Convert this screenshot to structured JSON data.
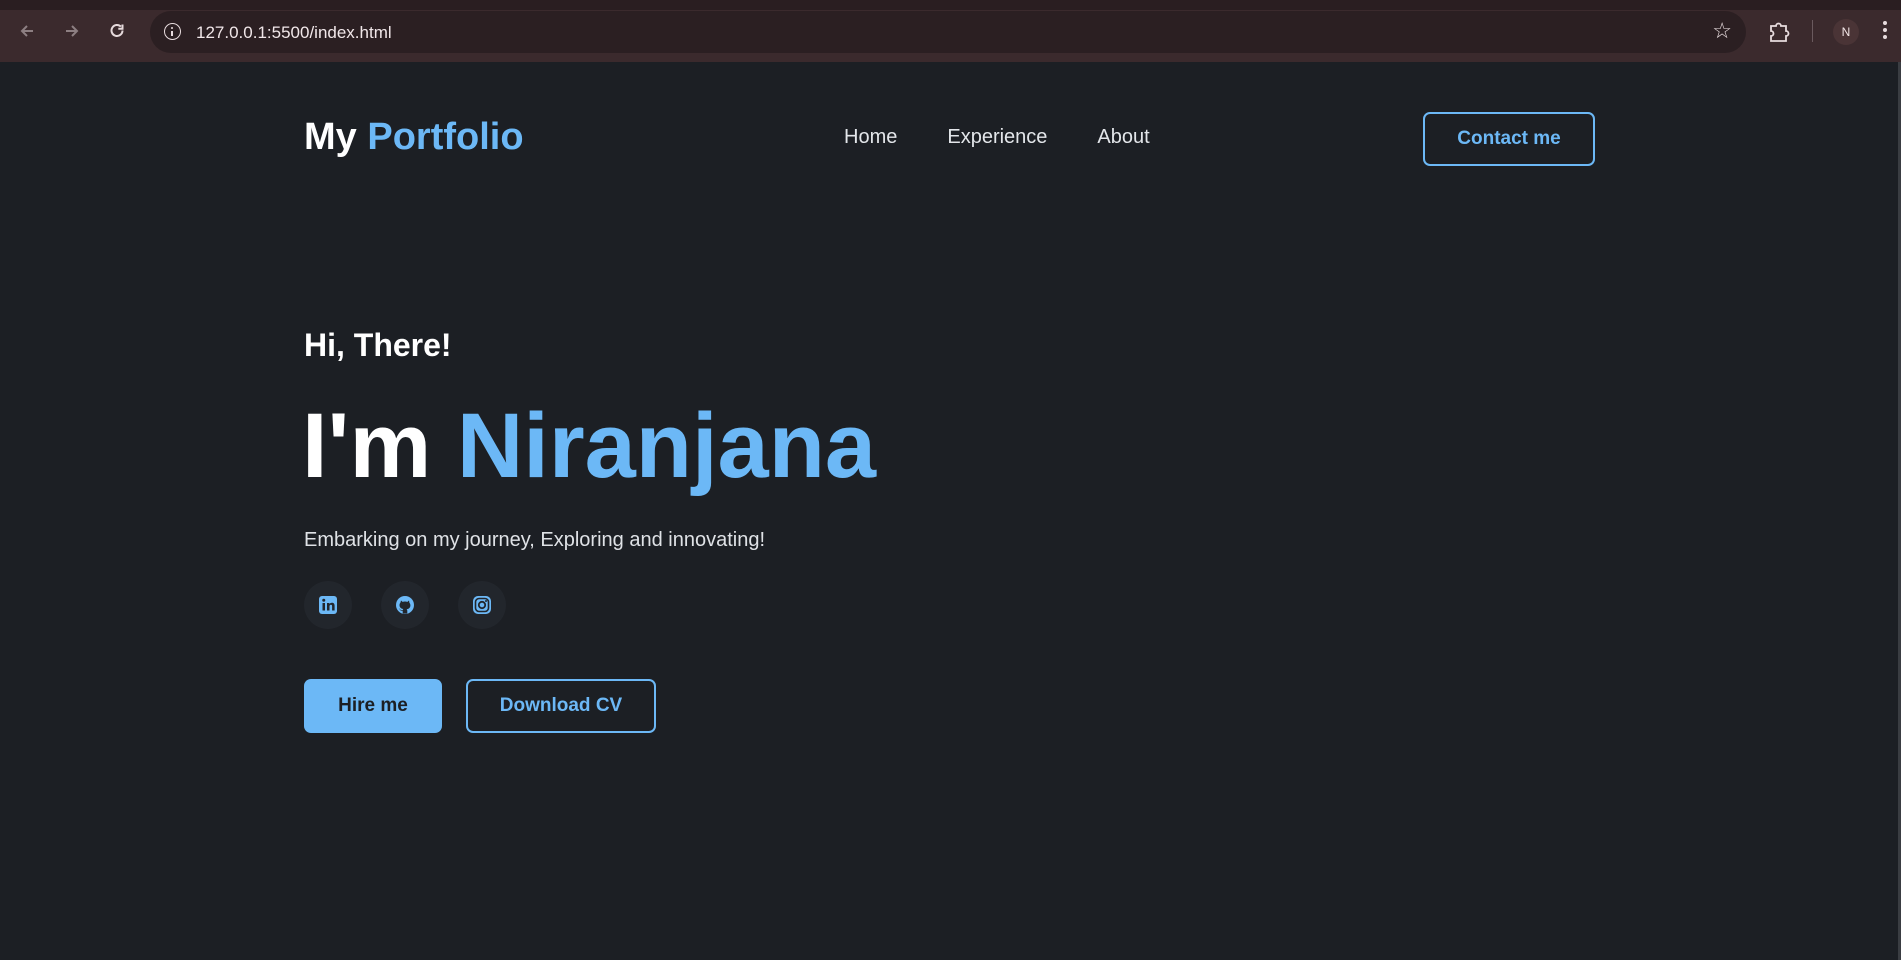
{
  "browser": {
    "url": "127.0.0.1:5500/index.html",
    "profile_initial": "N",
    "icons": [
      "back-arrow-icon",
      "forward-arrow-icon",
      "reload-icon",
      "info-icon",
      "star-icon",
      "extensions-icon",
      "kebab-menu-icon"
    ]
  },
  "header": {
    "logo_prefix": "My",
    "logo_accent": "Portfolio",
    "nav": [
      "Home",
      "Experience",
      "About"
    ],
    "contact_label": "Contact me"
  },
  "hero": {
    "greeting": "Hi, There!",
    "name_prefix": "I'm",
    "name_accent": "Niranjana",
    "tagline": "Embarking on my journey, Exploring and innovating!",
    "socials": [
      "linkedin-icon",
      "github-icon",
      "instagram-icon"
    ],
    "hire_label": "Hire me",
    "cv_label": "Download CV"
  },
  "colors": {
    "accent": "#6cb8f6",
    "background": "#1c1f24",
    "chrome": "#3b2a2d"
  }
}
